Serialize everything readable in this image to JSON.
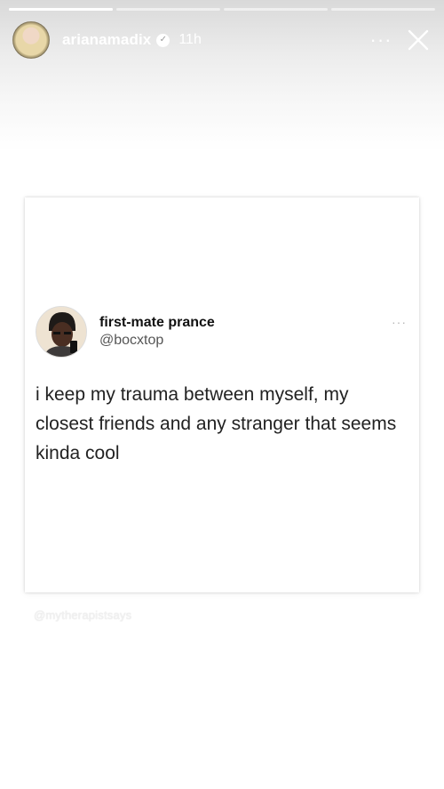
{
  "story": {
    "progress": [
      1,
      0,
      0,
      0
    ],
    "username": "arianamadix",
    "time": "11h",
    "verified_icon": "verified-badge-icon",
    "more_label": "···",
    "close_icon": "close-x-icon"
  },
  "tweet": {
    "display_name": "first-mate prance",
    "handle": "@bocxtop",
    "more_label": "···",
    "text": "i keep my trauma between myself, my closest friends and any stranger that seems kinda cool"
  },
  "watermark": "@mytherapistsays"
}
